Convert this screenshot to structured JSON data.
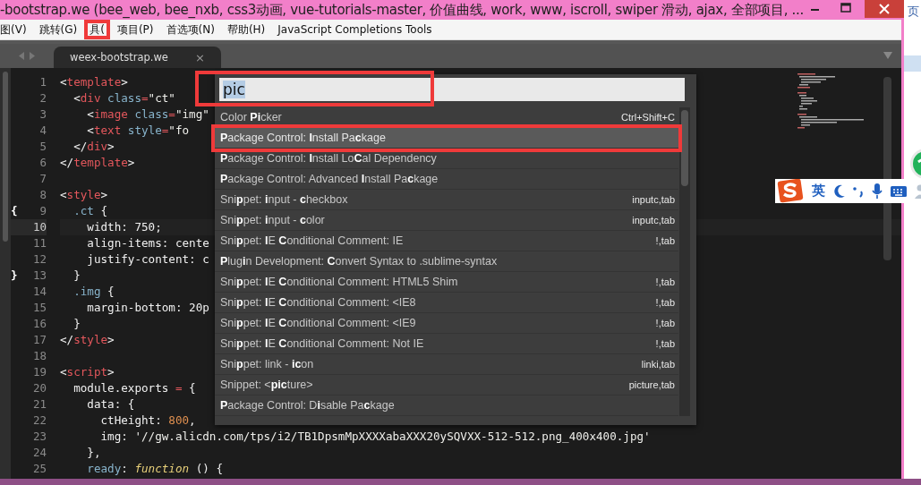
{
  "window": {
    "title": "-bootstrap.we (bee_web, bee_nxb, css3动画, vue-tutorials-master, 价值曲线, work, www, iscroll, swiper  滑动, ajax, 全部项目, ..."
  },
  "menu": [
    {
      "label": "图(V)",
      "annotated": false
    },
    {
      "label": "跳转(G)",
      "annotated": false
    },
    {
      "label": "具(",
      "annotated": true
    },
    {
      "label": "项目(P)",
      "annotated": false
    },
    {
      "label": "首选项(N)",
      "annotated": false
    },
    {
      "label": "帮助(H)",
      "annotated": false
    },
    {
      "label": "JavaScript Completions Tools",
      "annotated": false
    }
  ],
  "tabs": [
    {
      "label": "weex-bootstrap.we",
      "close": "×",
      "selected": true
    }
  ],
  "editor": {
    "lines": [
      {
        "number": "1",
        "active": false,
        "tokens": [
          {
            "text": "<",
            "kind": "punct"
          },
          {
            "text": "template",
            "kind": "tag"
          },
          {
            "text": ">",
            "kind": "punct"
          }
        ]
      },
      {
        "number": "2",
        "active": false,
        "tokens": [
          {
            "text": "  <",
            "kind": "punct"
          },
          {
            "text": "div",
            "kind": "tag"
          },
          {
            "text": " class",
            "kind": "attr"
          },
          {
            "text": "=",
            "kind": "op"
          },
          {
            "text": "\"ct\"",
            "kind": "string"
          }
        ]
      },
      {
        "number": "3",
        "active": false,
        "tokens": [
          {
            "text": "    <",
            "kind": "punct"
          },
          {
            "text": "image",
            "kind": "tag"
          },
          {
            "text": " class",
            "kind": "attr"
          },
          {
            "text": "=",
            "kind": "op"
          },
          {
            "text": "\"img\"",
            "kind": "string"
          }
        ]
      },
      {
        "number": "4",
        "active": false,
        "tokens": [
          {
            "text": "    <",
            "kind": "punct"
          },
          {
            "text": "text",
            "kind": "tag"
          },
          {
            "text": " style",
            "kind": "attr"
          },
          {
            "text": "=",
            "kind": "op"
          },
          {
            "text": "\"fo",
            "kind": "string"
          }
        ]
      },
      {
        "number": "5",
        "active": false,
        "tokens": [
          {
            "text": "  </",
            "kind": "punct"
          },
          {
            "text": "div",
            "kind": "tag"
          },
          {
            "text": ">",
            "kind": "punct"
          }
        ]
      },
      {
        "number": "6",
        "active": false,
        "tokens": [
          {
            "text": "</",
            "kind": "punct"
          },
          {
            "text": "template",
            "kind": "tag"
          },
          {
            "text": ">",
            "kind": "punct"
          }
        ]
      },
      {
        "number": "7",
        "active": false
      },
      {
        "number": "8",
        "active": false,
        "tokens": [
          {
            "text": "<",
            "kind": "punct"
          },
          {
            "text": "style",
            "kind": "tag"
          },
          {
            "text": ">",
            "kind": "punct"
          }
        ]
      },
      {
        "number": "9",
        "active": false,
        "bracket_mark": "{",
        "tokens": [
          {
            "text": "  .ct",
            "kind": "attr"
          },
          {
            "text": " {",
            "kind": "punct"
          }
        ]
      },
      {
        "number": "10",
        "active": true,
        "tokens": [
          {
            "text": "    width: 750;",
            "kind": "punct"
          }
        ]
      },
      {
        "number": "11",
        "active": false,
        "tokens": [
          {
            "text": "    align-items: cente",
            "kind": "punct"
          }
        ]
      },
      {
        "number": "12",
        "active": false,
        "tokens": [
          {
            "text": "    justify-content: c",
            "kind": "punct"
          }
        ]
      },
      {
        "number": "13",
        "active": false,
        "bracket_mark": "}",
        "tokens": [
          {
            "text": "  }",
            "kind": "punct"
          }
        ]
      },
      {
        "number": "14",
        "active": false,
        "tokens": [
          {
            "text": "  .img",
            "kind": "attr"
          },
          {
            "text": " {",
            "kind": "punct"
          }
        ]
      },
      {
        "number": "15",
        "active": false,
        "tokens": [
          {
            "text": "    margin-bottom: 20p",
            "kind": "punct"
          }
        ]
      },
      {
        "number": "16",
        "active": false,
        "tokens": [
          {
            "text": "  }",
            "kind": "punct"
          }
        ]
      },
      {
        "number": "17",
        "active": false,
        "tokens": [
          {
            "text": "</",
            "kind": "punct"
          },
          {
            "text": "style",
            "kind": "tag"
          },
          {
            "text": ">",
            "kind": "punct"
          }
        ]
      },
      {
        "number": "18",
        "active": false
      },
      {
        "number": "19",
        "active": false,
        "tokens": [
          {
            "text": "<",
            "kind": "punct"
          },
          {
            "text": "script",
            "kind": "tag"
          },
          {
            "text": ">",
            "kind": "punct"
          }
        ]
      },
      {
        "number": "20",
        "active": false,
        "tokens": [
          {
            "text": "  module.exports ",
            "kind": "punct"
          },
          {
            "text": "=",
            "kind": "op"
          },
          {
            "text": " {",
            "kind": "punct"
          }
        ]
      },
      {
        "number": "21",
        "active": false,
        "tokens": [
          {
            "text": "    data: {",
            "kind": "punct"
          }
        ]
      },
      {
        "number": "22",
        "active": false,
        "tokens": [
          {
            "text": "      ctHeight: ",
            "kind": "punct"
          },
          {
            "text": "800",
            "kind": "number"
          },
          {
            "text": ",",
            "kind": "punct"
          }
        ]
      },
      {
        "number": "23",
        "active": false,
        "tokens": [
          {
            "text": "      img: ",
            "kind": "punct"
          },
          {
            "text": "'//gw.alicdn.com/tps/i2/TB1DpsmMpXXXXabaXXX20ySQVXX-512-512.png_400x400.jpg'",
            "kind": "string"
          }
        ]
      },
      {
        "number": "24",
        "active": false,
        "tokens": [
          {
            "text": "    },",
            "kind": "punct"
          }
        ]
      },
      {
        "number": "25",
        "active": false,
        "tokens": [
          {
            "text": "    ready",
            "kind": "attr"
          },
          {
            "text": ": ",
            "kind": "punct"
          },
          {
            "text": "function",
            "kind": "keyword"
          },
          {
            "text": " () {",
            "kind": "punct"
          }
        ]
      }
    ]
  },
  "palette": {
    "query": "pic",
    "query_selected": true,
    "items": [
      {
        "label": "Color **Pi**cker",
        "shortcut": "Ctrl+Shift+C",
        "selected": false,
        "annotated": false
      },
      {
        "label": "**P**ackage Control: **I**nstall Pa**c**kage",
        "selected": true,
        "annotated": true
      },
      {
        "label": "**P**ackage Control: **I**nstall Lo**C**al Dependency",
        "selected": false,
        "annotated": false
      },
      {
        "label": "**P**ackage Control: Advanced **I**nstall Pa**c**kage",
        "selected": false,
        "annotated": false
      },
      {
        "label": "Sni**p**pet: **i**nput - **c**heckbox",
        "shortcut": "inputc,tab",
        "selected": false,
        "annotated": false
      },
      {
        "label": "Sni**p**pet: **i**nput - **c**olor",
        "shortcut": "inputc,tab",
        "selected": false,
        "annotated": false
      },
      {
        "label": "Sni**p**pet: **I**E **C**onditional Comment: IE",
        "shortcut": "!,tab",
        "selected": false,
        "annotated": false
      },
      {
        "label": "**P**lug**i**n Development: **C**onvert Syntax to .sublime-syntax",
        "selected": false,
        "annotated": false
      },
      {
        "label": "Sni**p**pet: **I**E **C**onditional Comment: HTML5 Shim",
        "shortcut": "!,tab",
        "selected": false,
        "annotated": false
      },
      {
        "label": "Sni**p**pet: **I**E **C**onditional Comment: <IE8",
        "shortcut": "!,tab",
        "selected": false,
        "annotated": false
      },
      {
        "label": "Sni**p**pet: **I**E **C**onditional Comment: <IE9",
        "shortcut": "!,tab",
        "selected": false,
        "annotated": false
      },
      {
        "label": "Sni**p**pet: **I**E **C**onditional Comment: Not IE",
        "shortcut": "!,tab",
        "selected": false,
        "annotated": false
      },
      {
        "label": "Sni**p**pet: link - **ic**on",
        "shortcut": "linki,tab",
        "selected": false,
        "annotated": false
      },
      {
        "label": "Snippet: <**pic**ture>",
        "shortcut": "picture,tab",
        "selected": false,
        "annotated": false
      },
      {
        "label": "**P**ackage Control: D**i**sable Pa**c**kage",
        "selected": false,
        "annotated": false
      }
    ]
  },
  "ime_toolbar": {
    "mode": "英"
  },
  "background_window": {
    "text": "页"
  }
}
